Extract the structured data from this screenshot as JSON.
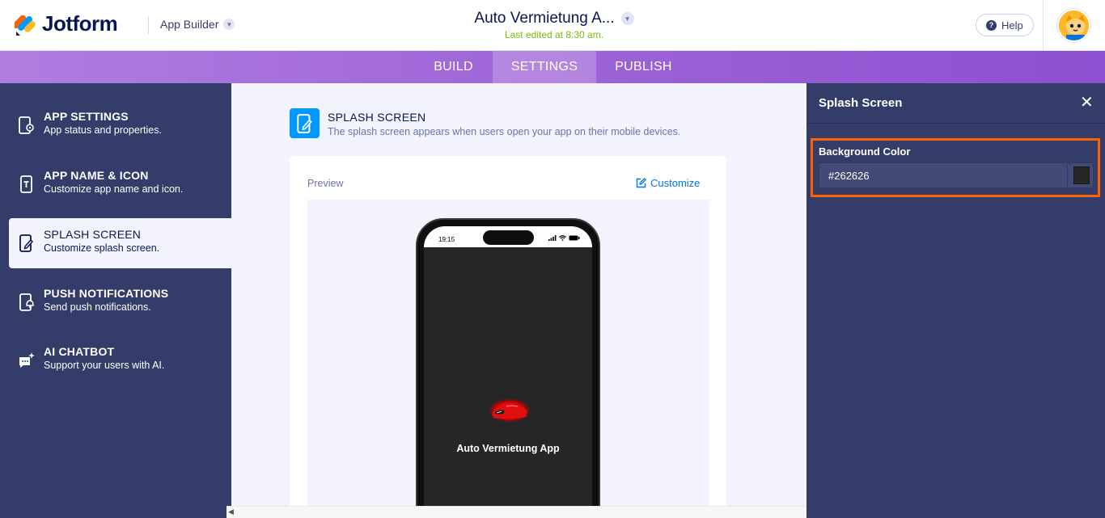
{
  "header": {
    "brand": "Jotform",
    "app_builder_label": "App Builder",
    "form_title": "Auto Vermietung A...",
    "last_edited": "Last edited at 8:30 am.",
    "help_label": "Help"
  },
  "tabs": [
    {
      "label": "BUILD",
      "active": false
    },
    {
      "label": "SETTINGS",
      "active": true
    },
    {
      "label": "PUBLISH",
      "active": false
    }
  ],
  "sidebar": {
    "items": [
      {
        "title": "APP SETTINGS",
        "subtitle": "App status and properties.",
        "icon": "phone-gear-icon",
        "active": false
      },
      {
        "title": "APP NAME & ICON",
        "subtitle": "Customize app name and icon.",
        "icon": "phone-text-icon",
        "active": false
      },
      {
        "title": "SPLASH SCREEN",
        "subtitle": "Customize splash screen.",
        "icon": "phone-edit-icon",
        "active": true
      },
      {
        "title": "PUSH NOTIFICATIONS",
        "subtitle": "Send push notifications.",
        "icon": "phone-bell-icon",
        "active": false
      },
      {
        "title": "AI CHATBOT",
        "subtitle": "Support your users with AI.",
        "icon": "chat-sparkle-icon",
        "active": false
      }
    ]
  },
  "main": {
    "section_title": "SPLASH SCREEN",
    "section_desc": "The splash screen appears when users open your app on their mobile devices.",
    "preview_label": "Preview",
    "customize_label": "Customize",
    "phone": {
      "time": "19:15",
      "app_name": "Auto Vermietung App",
      "background_color": "#262626"
    }
  },
  "right_panel": {
    "title": "Splash Screen",
    "field_label": "Background Color",
    "color_value": "#262626",
    "swatch_color": "#262626"
  },
  "colors": {
    "nav_bg": "#343c6a",
    "accent_blue": "#0099ff",
    "highlight": "#ff6100",
    "tabbar": "#9b5fd6",
    "last_edited": "#78bb07"
  }
}
